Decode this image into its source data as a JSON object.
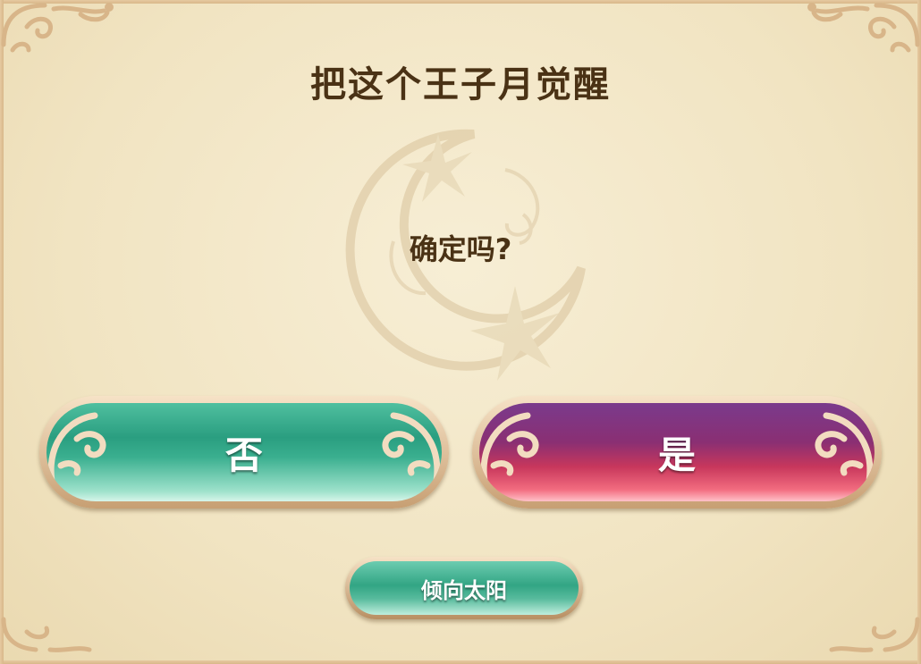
{
  "dialog": {
    "title": "把这个王子月觉醒",
    "question": "确定吗?"
  },
  "buttons": {
    "no_label": "否",
    "yes_label": "是",
    "sun_label": "倾向太阳"
  },
  "colors": {
    "background": "#f3e7c8",
    "text": "#4a3215",
    "no_button": "#2a9e80",
    "yes_button_top": "#7a3a8c",
    "yes_button_bottom": "#f26c7f",
    "sun_button": "#32a584"
  },
  "icons": {
    "emblem": "moon-star-emblem",
    "corner": "ornate-corner-icon",
    "swirl": "swirl-ornament-icon"
  }
}
